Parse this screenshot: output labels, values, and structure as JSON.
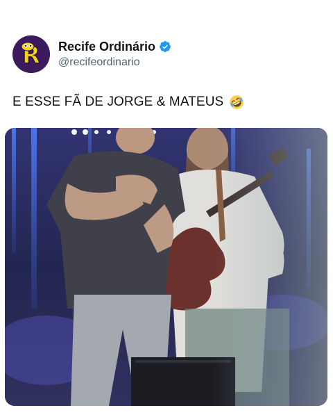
{
  "tweet": {
    "author": {
      "display_name": "Recife Ordinário",
      "handle": "@recifeordinario",
      "verified": true,
      "avatar_icon": "recife-ordinario-logo",
      "avatar_bg": "#3b1b5e",
      "avatar_accent": "#f5d31c"
    },
    "text": "E ESSE FÃ DE JORGE & MATEUS",
    "emoji_icon": "rolling-on-floor-laughing-emoji",
    "media": {
      "type": "video-frame",
      "description_icon": "concert-stage-photo"
    }
  },
  "colors": {
    "verified": "#1d9bf0",
    "text": "#0f1419",
    "secondary": "#536471"
  }
}
